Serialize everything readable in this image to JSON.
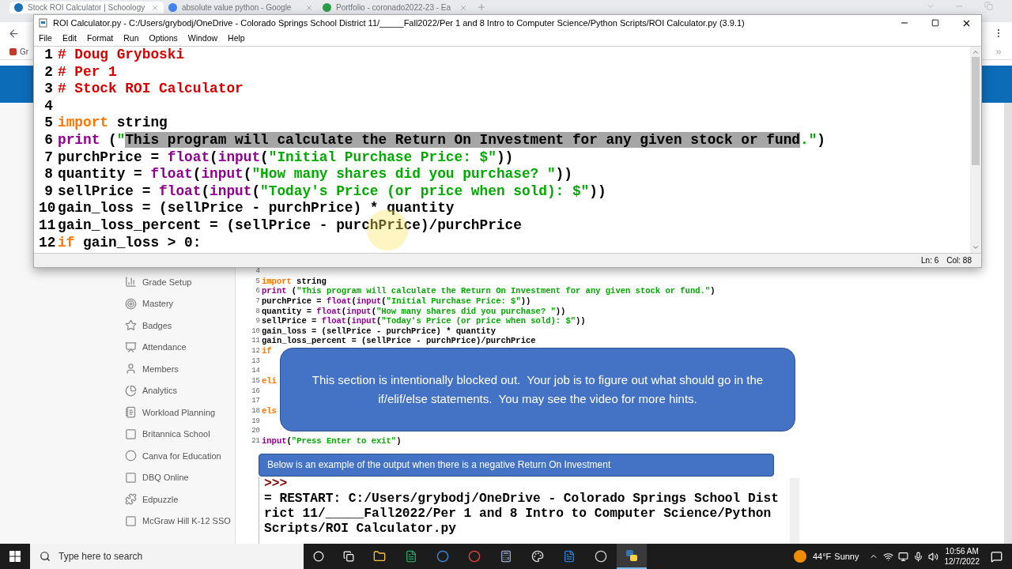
{
  "browser": {
    "tabs": [
      {
        "title": "Stock ROI Calculator | Schoology",
        "selected": true
      },
      {
        "title": "absolute value python - Google",
        "selected": false
      },
      {
        "title": "Portfolio - coronado2022-23 - Ea",
        "selected": false
      }
    ],
    "bookmark": "Gr"
  },
  "idle_window": {
    "title": "ROI Calculator.py - C:/Users/grybodj/OneDrive - Colorado Springs School District 11/_____Fall2022/Per 1 and 8 Intro to Computer Science/Python Scripts/ROI Calculator.py (3.9.1)",
    "menu": [
      "File",
      "Edit",
      "Format",
      "Run",
      "Options",
      "Window",
      "Help"
    ],
    "lines": [
      {
        "number": "1",
        "segments": [
          {
            "text": "# Doug Gryboski",
            "kind": "comment"
          }
        ]
      },
      {
        "number": "2",
        "segments": [
          {
            "text": "# Per 1",
            "kind": "comment"
          }
        ]
      },
      {
        "number": "3",
        "segments": [
          {
            "text": "# Stock ROI Calculator",
            "kind": "comment"
          }
        ]
      },
      {
        "number": "4"
      },
      {
        "number": "5",
        "segments": [
          {
            "text": "import",
            "kind": "keyword"
          },
          {
            "text": " string",
            "kind": "plain"
          }
        ]
      },
      {
        "number": "6",
        "segments": [
          {
            "text": "print",
            "kind": "builtin"
          },
          {
            "text": " (",
            "kind": "plain"
          },
          {
            "text": "\"",
            "kind": "string"
          },
          {
            "text": "This program will calculate the Return On Investment for any given stock or fund",
            "kind": "selection"
          },
          {
            "text": ".\"",
            "kind": "string"
          },
          {
            "text": ")",
            "kind": "plain"
          }
        ]
      },
      {
        "number": "7",
        "segments": [
          {
            "text": "purchPrice = ",
            "kind": "plain"
          },
          {
            "text": "float",
            "kind": "builtin"
          },
          {
            "text": "(",
            "kind": "plain"
          },
          {
            "text": "input",
            "kind": "builtin"
          },
          {
            "text": "(",
            "kind": "plain"
          },
          {
            "text": "\"Initial Purchase Price: $\"",
            "kind": "string"
          },
          {
            "text": "))",
            "kind": "plain"
          }
        ]
      },
      {
        "number": "8",
        "segments": [
          {
            "text": "quantity = ",
            "kind": "plain"
          },
          {
            "text": "float",
            "kind": "builtin"
          },
          {
            "text": "(",
            "kind": "plain"
          },
          {
            "text": "input",
            "kind": "builtin"
          },
          {
            "text": "(",
            "kind": "plain"
          },
          {
            "text": "\"How many shares did you purchase? \"",
            "kind": "string"
          },
          {
            "text": "))",
            "kind": "plain"
          }
        ]
      },
      {
        "number": "9",
        "segments": [
          {
            "text": "sellPrice = ",
            "kind": "plain"
          },
          {
            "text": "float",
            "kind": "builtin"
          },
          {
            "text": "(",
            "kind": "plain"
          },
          {
            "text": "input",
            "kind": "builtin"
          },
          {
            "text": "(",
            "kind": "plain"
          },
          {
            "text": "\"Today's Price (or price when sold): $\"",
            "kind": "string"
          },
          {
            "text": "))",
            "kind": "plain"
          }
        ]
      },
      {
        "number": "10",
        "segments": [
          {
            "text": "gain_loss = (sellPrice - purchPrice) * quantity",
            "kind": "plain"
          }
        ]
      },
      {
        "number": "11",
        "segments": [
          {
            "text": "gain_loss_percent = (sellPrice - purchPrice)/purchPrice",
            "kind": "plain"
          }
        ]
      },
      {
        "number": "12",
        "segments": [
          {
            "text": "if",
            "kind": "keyword"
          },
          {
            "text": " gain_loss > 0:",
            "kind": "plain"
          }
        ]
      }
    ],
    "status": {
      "line": "Ln: 6",
      "column": "Col: 88"
    }
  },
  "sidebar": {
    "items": [
      {
        "label": "Grade Setup"
      },
      {
        "label": "Mastery"
      },
      {
        "label": "Badges"
      },
      {
        "label": "Attendance"
      },
      {
        "label": "Members"
      },
      {
        "label": "Analytics"
      },
      {
        "label": "Workload Planning"
      },
      {
        "label": "Britannica School"
      },
      {
        "label": "Canva for Education"
      },
      {
        "label": "DBQ Online"
      },
      {
        "label": "Edpuzzle"
      },
      {
        "label": "McGraw Hill K-12 SSO"
      }
    ]
  },
  "code_image": {
    "lines": [
      {
        "number": "4"
      },
      {
        "number": "5",
        "segments": [
          {
            "text": "import",
            "kind": "keyword"
          },
          {
            "text": " string",
            "kind": "plain"
          }
        ]
      },
      {
        "number": "6",
        "segments": [
          {
            "text": "print",
            "kind": "builtin"
          },
          {
            "text": " (",
            "kind": "plain"
          },
          {
            "text": "\"This program will calculate the Return On Investment for any given stock or fund.\"",
            "kind": "string"
          },
          {
            "text": ")",
            "kind": "plain"
          }
        ]
      },
      {
        "number": "7",
        "segments": [
          {
            "text": "purchPrice = ",
            "kind": "plain"
          },
          {
            "text": "float",
            "kind": "builtin"
          },
          {
            "text": "(",
            "kind": "plain"
          },
          {
            "text": "input",
            "kind": "builtin"
          },
          {
            "text": "(",
            "kind": "plain"
          },
          {
            "text": "\"Initial Purchase Price: $\"",
            "kind": "string"
          },
          {
            "text": "))",
            "kind": "plain"
          }
        ]
      },
      {
        "number": "8",
        "segments": [
          {
            "text": "quantity = ",
            "kind": "plain"
          },
          {
            "text": "float",
            "kind": "builtin"
          },
          {
            "text": "(",
            "kind": "plain"
          },
          {
            "text": "input",
            "kind": "builtin"
          },
          {
            "text": "(",
            "kind": "plain"
          },
          {
            "text": "\"How many shares did you purchase? \"",
            "kind": "string"
          },
          {
            "text": "))",
            "kind": "plain"
          }
        ]
      },
      {
        "number": "9",
        "segments": [
          {
            "text": "sellPrice = ",
            "kind": "plain"
          },
          {
            "text": "float",
            "kind": "builtin"
          },
          {
            "text": "(",
            "kind": "plain"
          },
          {
            "text": "input",
            "kind": "builtin"
          },
          {
            "text": "(",
            "kind": "plain"
          },
          {
            "text": "\"Today's Price (or price when sold): $\"",
            "kind": "string"
          },
          {
            "text": "))",
            "kind": "plain"
          }
        ]
      },
      {
        "number": "10",
        "segments": [
          {
            "text": "gain_loss = (sellPrice - purchPrice) * quantity",
            "kind": "plain"
          }
        ]
      },
      {
        "number": "11",
        "segments": [
          {
            "text": "gain_loss_percent = (sellPrice - purchPrice)/purchPrice",
            "kind": "plain"
          }
        ]
      },
      {
        "number": "12",
        "segments": [
          {
            "text": "if",
            "kind": "keyword"
          }
        ]
      },
      {
        "number": "13"
      },
      {
        "number": "14"
      },
      {
        "number": "15",
        "segments": [
          {
            "text": "eli",
            "kind": "keyword"
          }
        ]
      },
      {
        "number": "16"
      },
      {
        "number": "17"
      },
      {
        "number": "18",
        "segments": [
          {
            "text": "els",
            "kind": "keyword"
          }
        ]
      },
      {
        "number": "19"
      },
      {
        "number": "20"
      },
      {
        "number": "21",
        "segments": [
          {
            "text": "input",
            "kind": "builtin"
          },
          {
            "text": "(",
            "kind": "plain"
          },
          {
            "text": "\"Press Enter to exit\"",
            "kind": "string"
          },
          {
            "text": ")",
            "kind": "plain"
          }
        ]
      }
    ],
    "callout": "This section is intentionally blocked out.  Your job is to figure out what should go in the if/elif/else statements.  You may see the video for more hints."
  },
  "output": {
    "banner": "Below is an example of the output when there is a negative Return On Investment",
    "lines": [
      {
        "text": ">>>",
        "kind": "prompt"
      },
      {
        "text": "= RESTART: C:/Users/grybodj/OneDrive - Colorado Springs School Dist",
        "kind": "plain"
      },
      {
        "text": "rict 11/_____Fall2022/Per 1 and 8 Intro to Computer Science/Python",
        "kind": "plain"
      },
      {
        "text": "Scripts/ROI Calculator.py",
        "kind": "plain"
      }
    ]
  },
  "taskbar": {
    "search_placeholder": "Type here to search",
    "temperature": "44°F",
    "weather": "Sunny",
    "time": "10:56 AM",
    "date": "12/7/2022"
  }
}
